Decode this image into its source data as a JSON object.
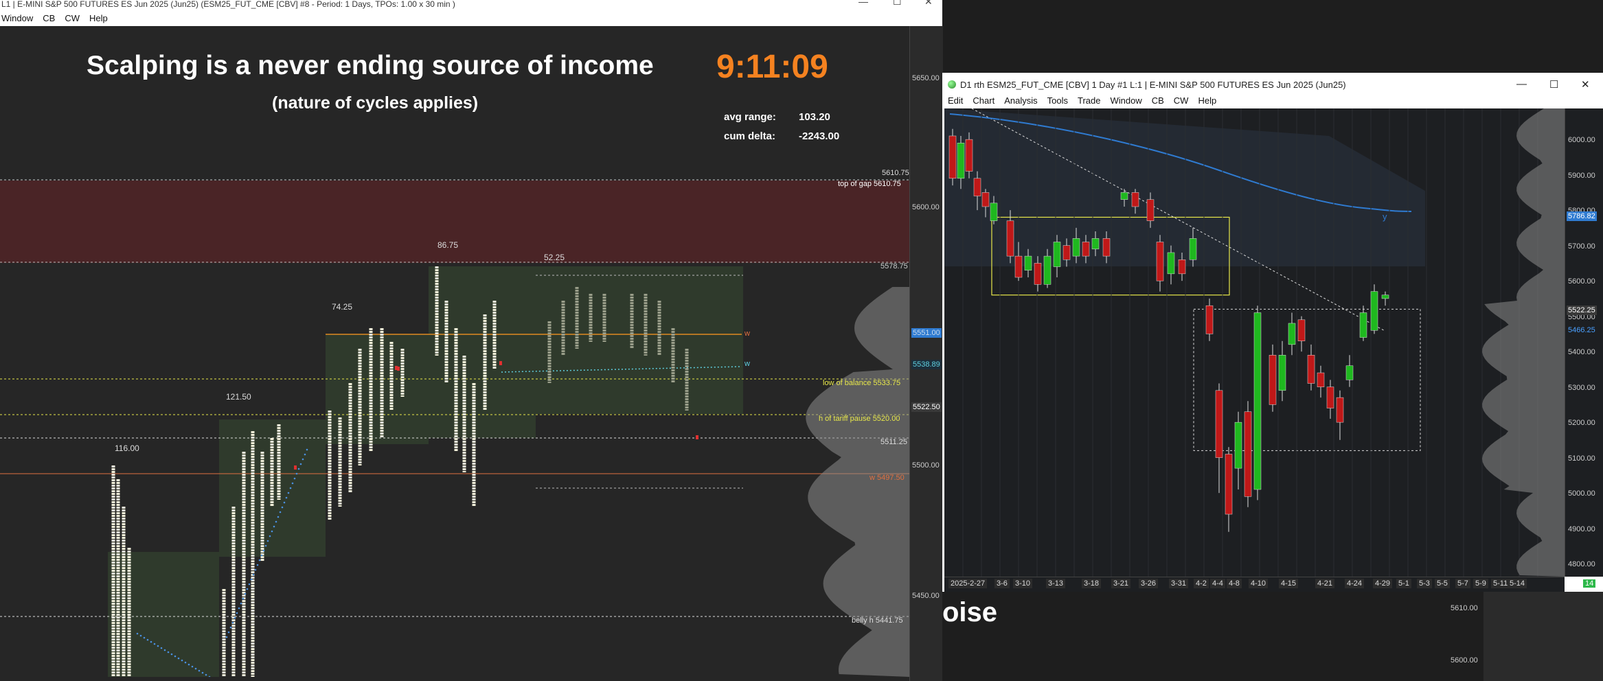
{
  "win1": {
    "title": "L1 | E-MINI S&P 500 FUTURES ES Jun 2025 (Jun25) (ESM25_FUT_CME [CBV] #8 - Period: 1 Days, TPOs: 1.00 x 30 min )",
    "menu": [
      "Window",
      "CB",
      "CW",
      "Help"
    ],
    "heading": "Scalping is a never ending source of income",
    "subheading": "(nature of cycles applies)",
    "clock": "9:11:09",
    "stats": [
      {
        "label": "avg range:",
        "value": "103.20"
      },
      {
        "label": "cum delta:",
        "value": "-2243.00"
      }
    ],
    "profile_labels": [
      "116.00",
      "121.50",
      "74.25",
      "86.75",
      "52.25"
    ],
    "levels": [
      {
        "label": "top of gap",
        "value": "5610.75",
        "color": "#ffffff",
        "extra": "5610.75"
      },
      {
        "label": "",
        "value": "5578.75",
        "color": "#cccccc",
        "extra": ""
      },
      {
        "label": "low of balance",
        "value": "5533.75",
        "color": "#e8e84a",
        "extra": ""
      },
      {
        "label": "h of tariff pause",
        "value": "5520.00",
        "color": "#e8e84a",
        "extra": ""
      },
      {
        "label": "",
        "value": "5511.25",
        "color": "#dddddd",
        "extra": ""
      },
      {
        "label": "w",
        "value": "5497.50",
        "color": "#e07040",
        "extra": ""
      },
      {
        "label": "belly h",
        "value": "5441.75",
        "color": "#dddddd",
        "extra": ""
      }
    ],
    "axis_ticks": [
      "5650.00",
      "5600.00",
      "5500.00",
      "5450.00"
    ],
    "axis_boxes": [
      {
        "text": "5551.00",
        "bg": "#2f7bd1",
        "color": "#cde"
      },
      {
        "text": "5538.89",
        "bg": "#1d2e3a",
        "color": "#5fd0e0"
      },
      {
        "text": "5522.50",
        "bg": "#3a3a3a",
        "color": "#ffffff"
      }
    ],
    "w_marks": [
      "w",
      "w"
    ]
  },
  "win2": {
    "title": "D1 rth ESM25_FUT_CME [CBV]  1 Day  #1 L:1 | E-MINI S&P 500 FUTURES ES Jun 2025 (Jun25)",
    "menu": [
      "Edit",
      "Chart",
      "Analysis",
      "Tools",
      "Trade",
      "Window",
      "CB",
      "CW",
      "Help"
    ],
    "axis_ticks": [
      "6000.00",
      "5900.00",
      "5800.00",
      "5700.00",
      "5600.00",
      "5500.00",
      "5400.00",
      "5300.00",
      "5200.00",
      "5100.00",
      "5000.00",
      "4900.00",
      "4800.00"
    ],
    "axis_boxes": [
      {
        "text": "5786.82",
        "bg": "#2f7bd1",
        "color": "#fff"
      },
      {
        "text": "5522.25",
        "bg": "#3a3a3a",
        "color": "#fff"
      },
      {
        "text": "5466.25",
        "bg": "#1d1f22",
        "color": "#4aa0ff"
      }
    ],
    "ma_label": "y",
    "dates": [
      "2025-2-27",
      "3-6",
      "3-10",
      "3-13",
      "3-18",
      "3-21",
      "3-26",
      "3-31",
      "4-2",
      "4-4",
      "4-8",
      "4-10",
      "4-15",
      "4-21",
      "4-24",
      "4-29",
      "5-1",
      "5-3",
      "5-5",
      "5-7",
      "5-9",
      "5-11",
      "5-14"
    ],
    "badge": "14"
  },
  "below": {
    "text": "oise",
    "ticks": [
      "5610.00",
      "5600.00"
    ]
  }
}
